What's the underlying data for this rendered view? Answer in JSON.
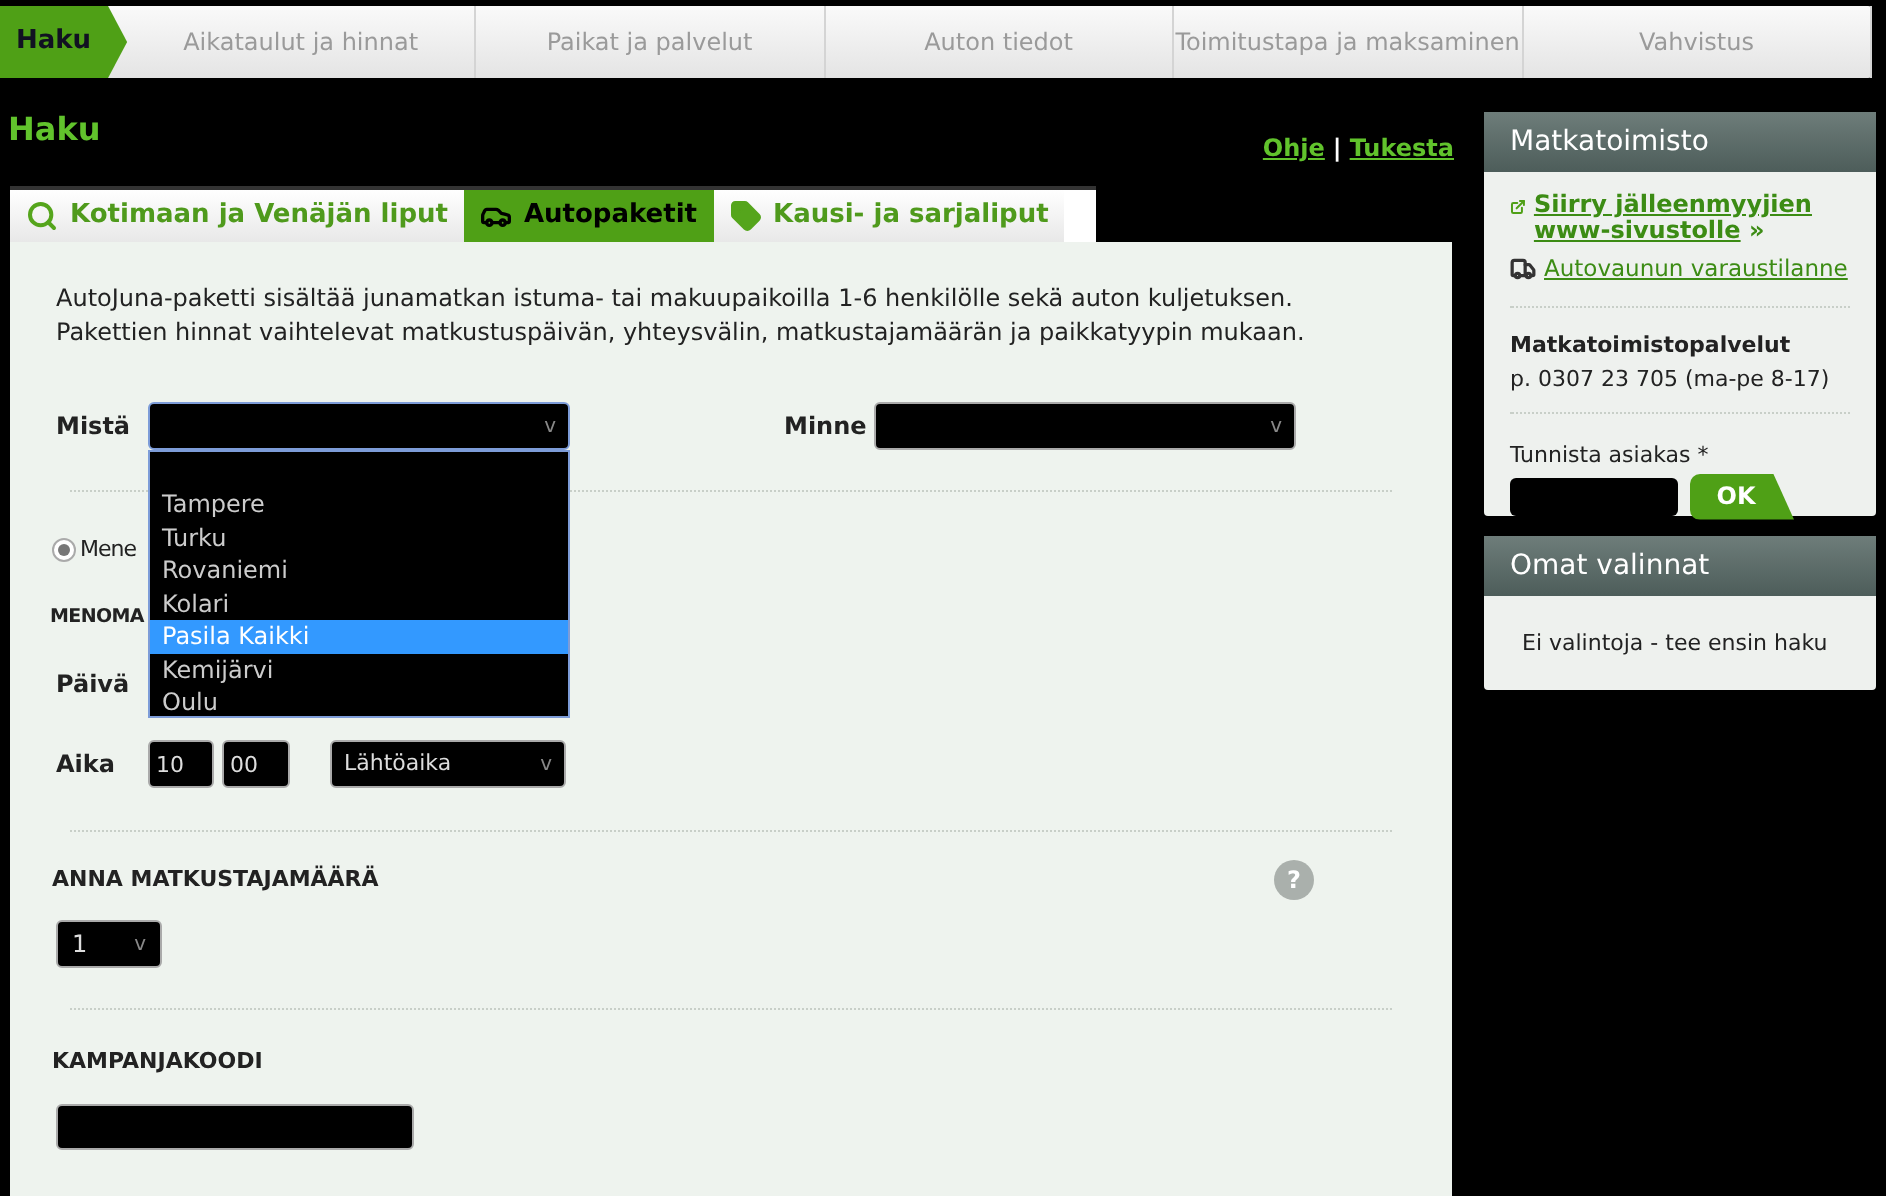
{
  "steps": [
    {
      "label": "Haku",
      "selected": true
    },
    {
      "label": "Aikataulut ja hinnat",
      "selected": false
    },
    {
      "label": "Paikat ja palvelut",
      "selected": false
    },
    {
      "label": "Auton tiedot",
      "selected": false
    },
    {
      "label": "Toimitustapa ja maksaminen",
      "selected": false
    },
    {
      "label": "Vahvistus",
      "selected": false
    }
  ],
  "heading": "Haku",
  "help_links": [
    {
      "label": "Ohje"
    },
    {
      "label": "Tukesta"
    }
  ],
  "help_separator": "|",
  "tabs": [
    {
      "label": "Kotimaan ja Venäjän liput",
      "kind": "search",
      "selected": false
    },
    {
      "label": "Autopaketit",
      "kind": "car",
      "selected": true
    },
    {
      "label": "Kausi- ja sarjaliput",
      "kind": "ticket",
      "selected": false
    }
  ],
  "intro": "AutoJuna-paketti sisältää junamatkan istuma- tai makuupaikoilla 1-6 henkilölle sekä auton kuljetuksen. Pakettien hinnat vaihtelevat matkustuspäivän, yhteysvälin, matkustajamäärän ja paikkatyypin mukaan.",
  "from": {
    "label": "Mistä",
    "caret": "v",
    "expanded": true,
    "options": [
      {
        "label": "Tampere",
        "selected": false
      },
      {
        "label": "Turku",
        "selected": false
      },
      {
        "label": "Rovaniemi",
        "selected": false
      },
      {
        "label": "Kolari",
        "selected": false
      },
      {
        "label": "Pasila Kaikki",
        "selected": true
      },
      {
        "label": "Kemijärvi",
        "selected": false
      },
      {
        "label": "Oulu",
        "selected": false
      }
    ]
  },
  "to": {
    "label": "Minne",
    "caret": "v"
  },
  "direction": {
    "label": "Mene",
    "checked": true
  },
  "section_outbound": "MENOMA",
  "date_label": "Päivä",
  "time": {
    "label": "Aika",
    "hour": "10",
    "minute": "00",
    "mode": "Lähtöaika",
    "caret": "v"
  },
  "passengers": {
    "title": "ANNA MATKUSTAJAMÄÄRÄ",
    "value": "1",
    "caret": "v",
    "help": "?"
  },
  "campaign": {
    "title": "KAMPANJAKOODI"
  },
  "agency": {
    "title": "Matkatoimisto",
    "link1": "Siirry jälleenmyyjien www-sivustolle",
    "link1_suffix": "»",
    "link2": "Autovaunun varaustilanne",
    "service_title": "Matkatoimistopalvelut",
    "service_phone": "p. 0307 23 705 (ma-pe 8-17)",
    "identify_label": "Tunnista asiakas *",
    "ok": "OK"
  },
  "choices": {
    "title": "Omat valinnat",
    "empty": "Ei valintoja - tee ensin haku"
  }
}
